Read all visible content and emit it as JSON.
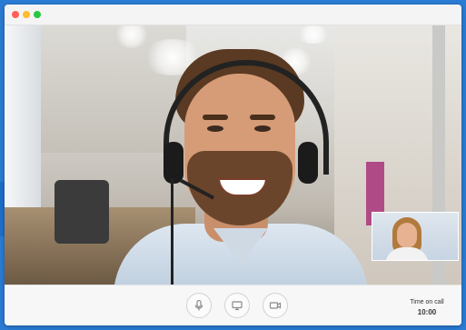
{
  "window": {
    "controls": [
      "close",
      "minimize",
      "maximize"
    ]
  },
  "controls": {
    "icons": [
      "microphone-icon",
      "screen-share-icon",
      "video-camera-icon"
    ]
  },
  "timer": {
    "label": "Time on call",
    "value": "10:00"
  },
  "colors": {
    "close": "#ff5f57",
    "minimize": "#febc2e",
    "maximize": "#28c840",
    "desktop": "#2a7bd3"
  }
}
